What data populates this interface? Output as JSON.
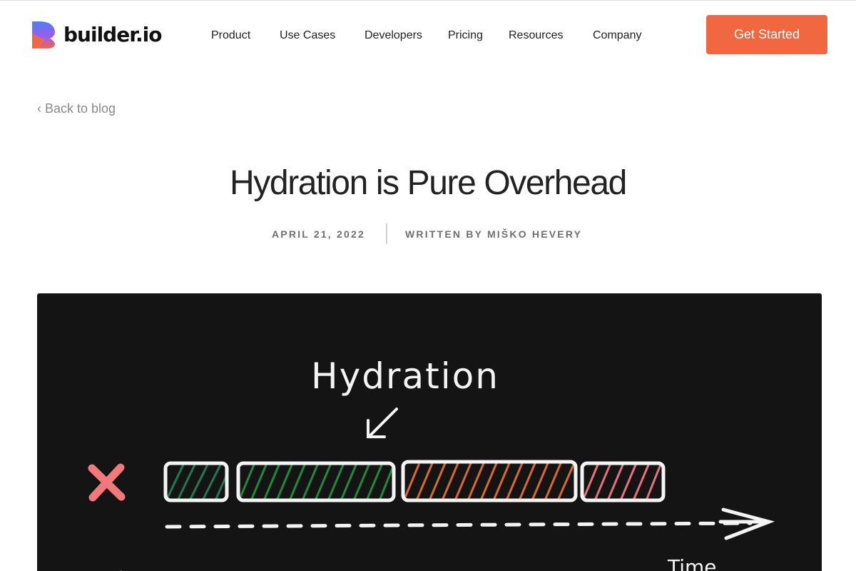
{
  "header": {
    "logo_text": "builder.io",
    "nav": [
      {
        "label": "Product"
      },
      {
        "label": "Use Cases"
      },
      {
        "label": "Developers"
      },
      {
        "label": "Pricing"
      },
      {
        "label": "Resources"
      },
      {
        "label": "Company"
      }
    ],
    "cta_label": "Get Started"
  },
  "back_link": {
    "chevron": "‹",
    "label": "Back to blog"
  },
  "article": {
    "title": "Hydration is Pure Overhead",
    "date": "APRIL 21, 2022",
    "author": "WRITTEN BY MIŠKO HEVERY"
  },
  "hero": {
    "heading": "Hydration",
    "axis_label": "Time"
  },
  "colors": {
    "accent": "#f1673f",
    "hero_bg": "#141414",
    "green": "#1f8a3c",
    "teal_green": "#1d7a55",
    "orange": "#d9692a",
    "pink": "#e8707a",
    "cross": "#f2787c"
  }
}
